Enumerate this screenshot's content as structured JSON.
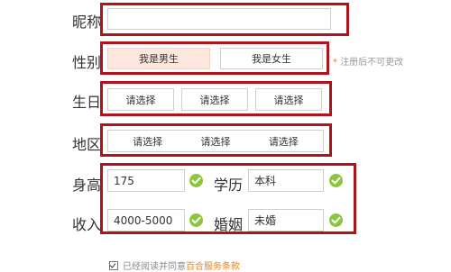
{
  "form": {
    "nickname": {
      "label": "昵称",
      "value": "",
      "placeholder": ""
    },
    "gender": {
      "label": "性别",
      "options": [
        "我是男生",
        "我是女生"
      ],
      "selected_index": 0,
      "note_star": "*",
      "note": "注册后不可更改"
    },
    "birthday": {
      "label": "生日",
      "selects": [
        "请选择",
        "请选择",
        "请选择"
      ]
    },
    "region": {
      "label": "地区",
      "selects": [
        "请选择",
        "请选择",
        "请选择"
      ]
    },
    "height": {
      "label": "身高",
      "value": "175",
      "valid": true
    },
    "education": {
      "label": "学历",
      "value": "本科",
      "valid": true
    },
    "income": {
      "label": "收入",
      "value": "4000-5000",
      "valid": true
    },
    "marriage": {
      "label": "婚姻",
      "value": "未婚",
      "valid": true
    },
    "agreement": {
      "checked": true,
      "text": "已经阅读并同意",
      "link": "百合服务条款"
    }
  },
  "colors": {
    "highlight_border": "#b0141a",
    "selected_bg": "#fde7dc",
    "valid_green": "#8cc63f",
    "accent_orange": "#e8831e"
  }
}
